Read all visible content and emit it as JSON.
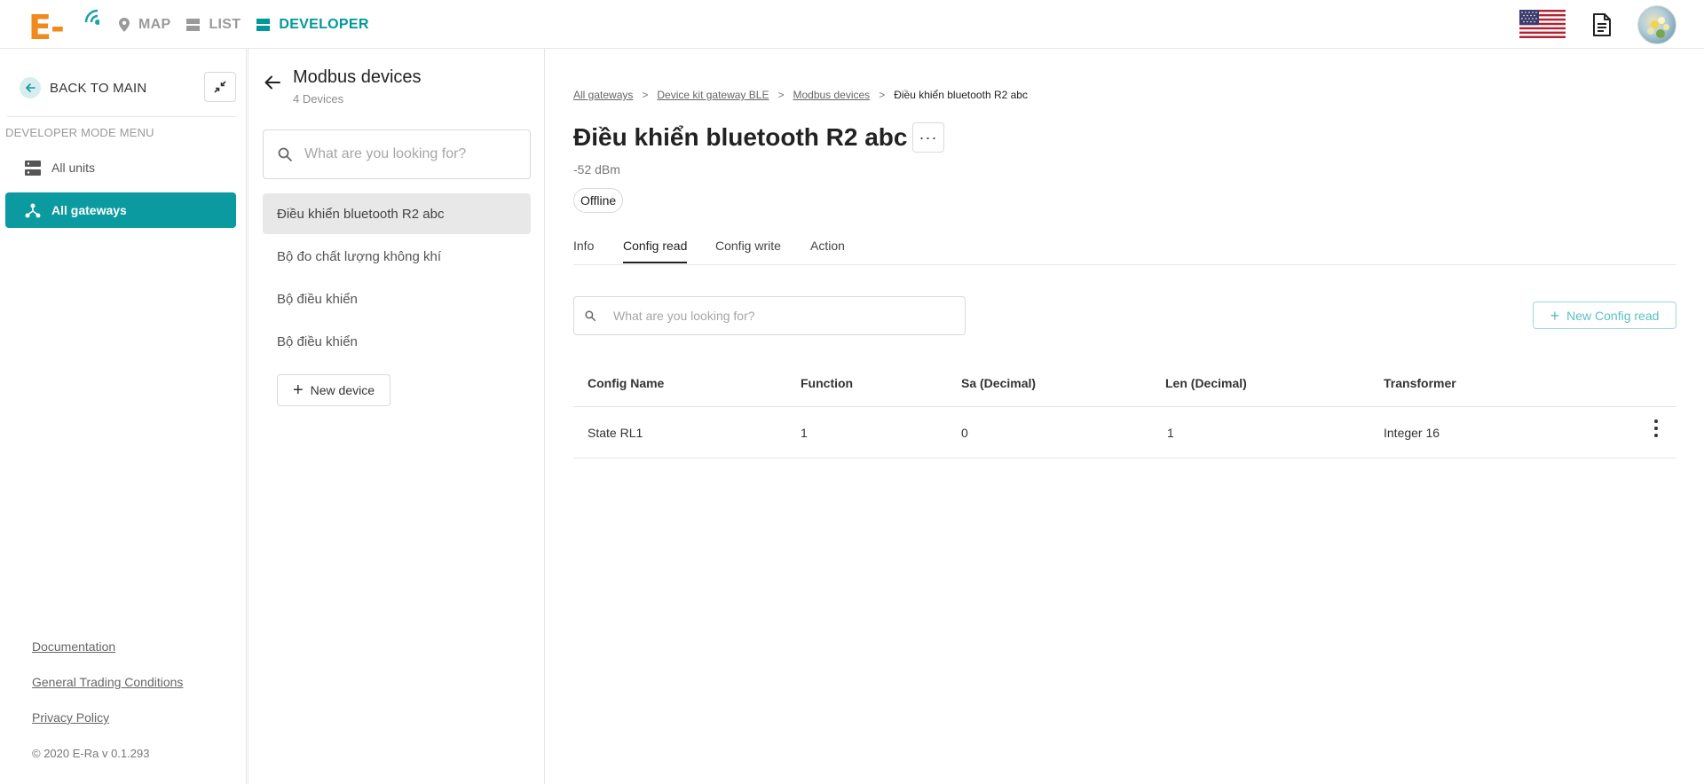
{
  "app": {
    "logo_text": "E-Ra"
  },
  "topnav": {
    "items": [
      {
        "label": "MAP",
        "icon": "map-pin-icon"
      },
      {
        "label": "LIST",
        "icon": "list-icon"
      },
      {
        "label": "DEVELOPER",
        "icon": "developer-icon",
        "active": true
      }
    ],
    "accent": "#00979d"
  },
  "sidebar": {
    "back_label": "BACK TO MAIN",
    "menu_title": "DEVELOPER MODE MENU",
    "items": [
      {
        "label": "All units",
        "icon": "units-icon"
      },
      {
        "label": "All gateways",
        "icon": "gateway-icon",
        "active": true
      }
    ],
    "footer_links": [
      "Documentation",
      "General Trading Conditions",
      "Privacy Policy"
    ],
    "copyright": "© 2020 E-Ra v 0.1.293",
    "active_color": "#0a9a9f"
  },
  "devices_panel": {
    "title": "Modbus devices",
    "count_label": "4 Devices",
    "search_placeholder": "What are you looking for?",
    "devices": [
      "Điều khiển bluetooth R2 abc",
      "Bộ đo chất lượng không khí",
      "Bộ điều khiển",
      "Bộ điều khiển"
    ],
    "selected_index": 0,
    "new_device_label": "New device"
  },
  "main": {
    "breadcrumb": [
      "All gateways",
      "Device kit gateway BLE",
      "Modbus devices",
      "Điều khiển bluetooth R2 abc"
    ],
    "breadcrumb_sep": ">",
    "title": "Điều khiển bluetooth R2 abc",
    "more_label": "···",
    "signal": "-52 dBm",
    "status": "Offline",
    "tabs": [
      "Info",
      "Config read",
      "Config write",
      "Action"
    ],
    "active_tab": 1,
    "search_placeholder": "What are you looking for?",
    "new_config_label": "New Config read",
    "table": {
      "columns": [
        "Config Name",
        "Function",
        "Sa (Decimal)",
        "Len (Decimal)",
        "Transformer"
      ],
      "rows": [
        [
          "State RL1",
          "1",
          "0",
          "1",
          "Integer 16"
        ]
      ]
    }
  }
}
